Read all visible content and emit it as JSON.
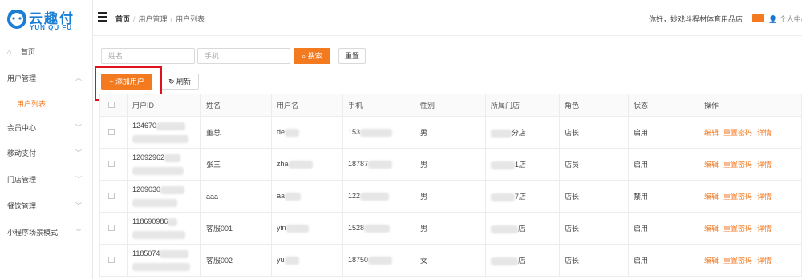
{
  "brand": {
    "name_cn": "云趣付",
    "name_en": "YUN QU FU",
    "color": "#1a7fd4"
  },
  "accent_color": "#f47a20",
  "sidebar": {
    "items": [
      {
        "label": "首页",
        "icon": "home-icon"
      },
      {
        "label": "用户管理",
        "expanded": true
      },
      {
        "label": "用户列表",
        "active": true
      },
      {
        "label": "会员中心"
      },
      {
        "label": "移动支付"
      },
      {
        "label": "门店管理"
      },
      {
        "label": "餐饮管理"
      },
      {
        "label": "小程序场景模式"
      }
    ]
  },
  "header": {
    "breadcrumb": [
      "首页",
      "用户管理",
      "用户列表"
    ],
    "greeting": "你好，妙戏斗程材体育用品店",
    "user_menu": "个人中心"
  },
  "search": {
    "name_placeholder": "姓名",
    "phone_placeholder": "手机",
    "search_label": "搜索",
    "reset_label": "重置"
  },
  "actions": {
    "add_label": "添加用户",
    "refresh_label": "刷新"
  },
  "table": {
    "columns": [
      "用户ID",
      "姓名",
      "用户名",
      "手机",
      "性别",
      "所属门店",
      "角色",
      "状态",
      "操作"
    ],
    "rows": [
      {
        "uid": "124670",
        "name": "董总",
        "username": "de",
        "phone": "153",
        "gender": "男",
        "store": "分店",
        "role": "店长",
        "status": "启用"
      },
      {
        "uid": "12092962",
        "name": "张三",
        "username": "zha",
        "phone": "18787",
        "gender": "男",
        "store": "1店",
        "role": "店员",
        "status": "启用"
      },
      {
        "uid": "1209030",
        "name": "aaa",
        "username": "aa",
        "phone": "122",
        "gender": "男",
        "store": "7店",
        "role": "店长",
        "status": "禁用"
      },
      {
        "uid": "118690986",
        "name": "客服001",
        "username": "yin",
        "phone": "1528",
        "gender": "男",
        "store": "店",
        "role": "店长",
        "status": "启用"
      },
      {
        "uid": "1185074",
        "name": "客服002",
        "username": "yu",
        "phone": "18750",
        "gender": "女",
        "store": "店",
        "role": "店长",
        "status": "启用"
      }
    ],
    "ops": [
      "编辑",
      "重置密码",
      "详情"
    ]
  }
}
